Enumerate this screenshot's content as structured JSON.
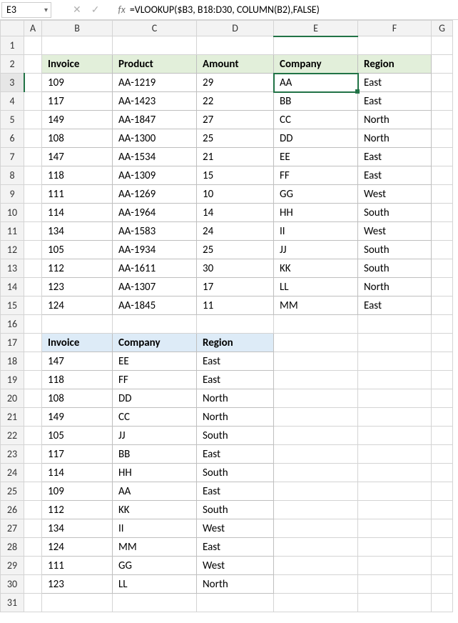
{
  "nameBox": "E3",
  "formula": "=VLOOKUP($B3, B18:D30, COLUMN(B2),FALSE)",
  "icons": {
    "cancel": "✕",
    "confirm": "✓",
    "fx": "fx",
    "dropdown": "▾"
  },
  "columns": [
    "",
    "A",
    "B",
    "C",
    "D",
    "E",
    "F",
    "G"
  ],
  "selectedCell": {
    "row": 3,
    "col": "E"
  },
  "rows": [
    {
      "n": 1
    },
    {
      "n": 2,
      "table": "t1head",
      "cells": {
        "B": "Invoice",
        "C": "Product",
        "D": "Amount",
        "E": "Company",
        "F": "Region"
      }
    },
    {
      "n": 3,
      "table": "t1",
      "cells": {
        "B": "109",
        "C": "AA-1219",
        "D": "29",
        "E": "AA",
        "F": "East"
      }
    },
    {
      "n": 4,
      "table": "t1",
      "cells": {
        "B": "117",
        "C": "AA-1423",
        "D": "22",
        "E": "BB",
        "F": "East"
      }
    },
    {
      "n": 5,
      "table": "t1",
      "cells": {
        "B": "149",
        "C": "AA-1847",
        "D": "27",
        "E": "CC",
        "F": "North"
      }
    },
    {
      "n": 6,
      "table": "t1",
      "cells": {
        "B": "108",
        "C": "AA-1300",
        "D": "25",
        "E": "DD",
        "F": "North"
      }
    },
    {
      "n": 7,
      "table": "t1",
      "cells": {
        "B": "147",
        "C": "AA-1534",
        "D": "21",
        "E": "EE",
        "F": "East"
      }
    },
    {
      "n": 8,
      "table": "t1",
      "cells": {
        "B": "118",
        "C": "AA-1309",
        "D": "15",
        "E": "FF",
        "F": "East"
      }
    },
    {
      "n": 9,
      "table": "t1",
      "cells": {
        "B": "111",
        "C": "AA-1269",
        "D": "10",
        "E": "GG",
        "F": "West"
      }
    },
    {
      "n": 10,
      "table": "t1",
      "cells": {
        "B": "114",
        "C": "AA-1964",
        "D": "14",
        "E": "HH",
        "F": "South"
      }
    },
    {
      "n": 11,
      "table": "t1",
      "cells": {
        "B": "134",
        "C": "AA-1583",
        "D": "24",
        "E": "II",
        "F": "West"
      }
    },
    {
      "n": 12,
      "table": "t1",
      "cells": {
        "B": "105",
        "C": "AA-1934",
        "D": "25",
        "E": "JJ",
        "F": "South"
      }
    },
    {
      "n": 13,
      "table": "t1",
      "cells": {
        "B": "112",
        "C": "AA-1611",
        "D": "30",
        "E": "KK",
        "F": "South"
      }
    },
    {
      "n": 14,
      "table": "t1",
      "cells": {
        "B": "123",
        "C": "AA-1307",
        "D": "17",
        "E": "LL",
        "F": "North"
      }
    },
    {
      "n": 15,
      "table": "t1",
      "cells": {
        "B": "124",
        "C": "AA-1845",
        "D": "11",
        "E": "MM",
        "F": "East"
      }
    },
    {
      "n": 16
    },
    {
      "n": 17,
      "table": "t2head",
      "cells": {
        "B": "Invoice",
        "C": "Company",
        "D": "Region"
      }
    },
    {
      "n": 18,
      "table": "t2",
      "cells": {
        "B": "147",
        "C": "EE",
        "D": "East"
      }
    },
    {
      "n": 19,
      "table": "t2",
      "cells": {
        "B": "118",
        "C": "FF",
        "D": "East"
      }
    },
    {
      "n": 20,
      "table": "t2",
      "cells": {
        "B": "108",
        "C": "DD",
        "D": "North"
      }
    },
    {
      "n": 21,
      "table": "t2",
      "cells": {
        "B": "149",
        "C": "CC",
        "D": "North"
      }
    },
    {
      "n": 22,
      "table": "t2",
      "cells": {
        "B": "105",
        "C": "JJ",
        "D": "South"
      }
    },
    {
      "n": 23,
      "table": "t2",
      "cells": {
        "B": "117",
        "C": "BB",
        "D": "East"
      }
    },
    {
      "n": 24,
      "table": "t2",
      "cells": {
        "B": "114",
        "C": "HH",
        "D": "South"
      }
    },
    {
      "n": 25,
      "table": "t2",
      "cells": {
        "B": "109",
        "C": "AA",
        "D": "East"
      }
    },
    {
      "n": 26,
      "table": "t2",
      "cells": {
        "B": "112",
        "C": "KK",
        "D": "South"
      }
    },
    {
      "n": 27,
      "table": "t2",
      "cells": {
        "B": "134",
        "C": "II",
        "D": "West"
      }
    },
    {
      "n": 28,
      "table": "t2",
      "cells": {
        "B": "124",
        "C": "MM",
        "D": "East"
      }
    },
    {
      "n": 29,
      "table": "t2",
      "cells": {
        "B": "111",
        "C": "GG",
        "D": "West"
      }
    },
    {
      "n": 30,
      "table": "t2",
      "cells": {
        "B": "123",
        "C": "LL",
        "D": "North"
      }
    },
    {
      "n": 31
    }
  ]
}
